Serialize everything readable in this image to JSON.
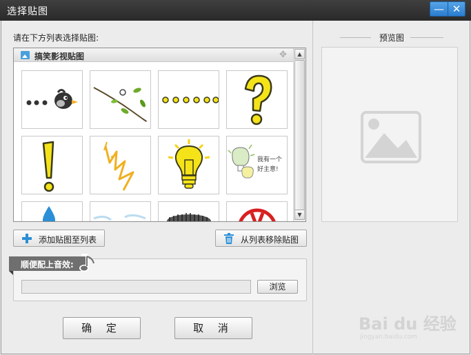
{
  "window": {
    "title": "选择贴图",
    "minimize": "—",
    "close": "✕"
  },
  "list": {
    "label": "请在下方列表选择贴图:",
    "category": "搞笑影视贴图",
    "tiles": [
      {
        "name": "sticker-bird-dots"
      },
      {
        "name": "sticker-branch"
      },
      {
        "name": "sticker-yellow-dots"
      },
      {
        "name": "sticker-question-mark"
      },
      {
        "name": "sticker-exclamation-mark"
      },
      {
        "name": "sticker-burst-lines"
      },
      {
        "name": "sticker-lightbulb"
      },
      {
        "name": "sticker-idea-bubble",
        "text": "我有一个好主意!"
      },
      {
        "name": "sticker-water-drop"
      },
      {
        "name": "sticker-splash"
      },
      {
        "name": "sticker-dark-cloud"
      },
      {
        "name": "sticker-red-sign"
      }
    ]
  },
  "buttons": {
    "add": "添加贴图至列表",
    "remove": "从列表移除贴图",
    "browse": "浏览",
    "ok": "确 定",
    "cancel": "取 消"
  },
  "sound": {
    "label": "顺便配上音效:",
    "path": ""
  },
  "preview": {
    "title": "预览图"
  },
  "watermark": {
    "brand": "Bai du 经验",
    "url": "jingyan.baidu.com"
  },
  "colors": {
    "accent_blue": "#2a8fd6",
    "sticker_yellow": "#f5e31a",
    "sticker_outline": "#3a3a1a"
  }
}
